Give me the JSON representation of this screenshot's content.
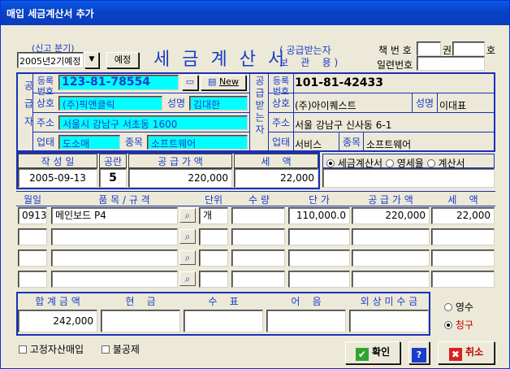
{
  "window": {
    "title": "매입 세금계산서 추가"
  },
  "period": {
    "label": "(신고 분기)",
    "value": "2005년2기예정",
    "button": "예정"
  },
  "doc": {
    "title": "세 금 계 산 서",
    "kind_top": "( 공급받는자",
    "kind_bottom": "보    관    용 )",
    "book_label": "책 번 호",
    "book_unit1": "권",
    "book_unit2": "호",
    "serial_label": "일련번호"
  },
  "supplier": {
    "side": "공급자",
    "reg_label": "등록번호",
    "reg_no": "123-81-78554",
    "new_label": "New",
    "name_label": "상호",
    "name": "(주)픽앤클릭",
    "rep_label": "성명",
    "rep": "김대한",
    "addr_label": "주소",
    "addr": "서울시 강남구 서초동 1600",
    "biz_label": "업태",
    "biz": "도소매",
    "item_label": "종목",
    "item": "소프트웨어"
  },
  "buyer": {
    "side": "공급받는자",
    "reg_label": "등록번호",
    "reg_no": "101-81-42433",
    "name_label": "상호",
    "name": "(주)아이퀘스트",
    "rep_label": "성명",
    "rep": "이대표",
    "addr_label": "주소",
    "addr": "서울 강남구 신사동 6-1",
    "biz_label": "업태",
    "biz": "서비스",
    "item_label": "종목",
    "item": "소프트웨어"
  },
  "summary": {
    "date_label": "작 성 일",
    "date": "2005-09-13",
    "blank_label": "공란",
    "blank": "5",
    "supply_label": "공 급 가 액",
    "supply": "220,000",
    "tax_label": "세    액",
    "tax": "22,000"
  },
  "doc_type": {
    "options": [
      "세금계산서",
      "영세율",
      "계산서"
    ],
    "selected": 0
  },
  "items": {
    "headers": [
      "월일",
      "품 목 / 규 격",
      "단위",
      "수 량",
      "단 가",
      "공 급 가 액",
      "세    액"
    ],
    "rows": [
      {
        "date": "0913",
        "name": "메인보드 P4",
        "unit": "개",
        "qty": "",
        "price": "110,000.0",
        "supply": "220,000",
        "tax": "22,000"
      },
      {
        "date": "",
        "name": "",
        "unit": "",
        "qty": "",
        "price": "",
        "supply": "",
        "tax": ""
      },
      {
        "date": "",
        "name": "",
        "unit": "",
        "qty": "",
        "price": "",
        "supply": "",
        "tax": ""
      },
      {
        "date": "",
        "name": "",
        "unit": "",
        "qty": "",
        "price": "",
        "supply": "",
        "tax": ""
      }
    ]
  },
  "totals": {
    "headers": [
      "합 계 금 액",
      "현    금",
      "수    표",
      "어    음",
      "외 상 미 수 금"
    ],
    "values": [
      "242,000",
      "",
      "",
      "",
      ""
    ]
  },
  "receipt": {
    "options": [
      "영수",
      "청구"
    ],
    "selected": 1
  },
  "options": {
    "fixed_asset": "고정자산매입",
    "no_deduct": "불공제"
  },
  "buttons": {
    "ok": "확인",
    "help": "?",
    "cancel": "취소"
  },
  "colors": {
    "accent": "#1a30b8",
    "cyan": "#00ffff",
    "title": "#0842c5"
  }
}
